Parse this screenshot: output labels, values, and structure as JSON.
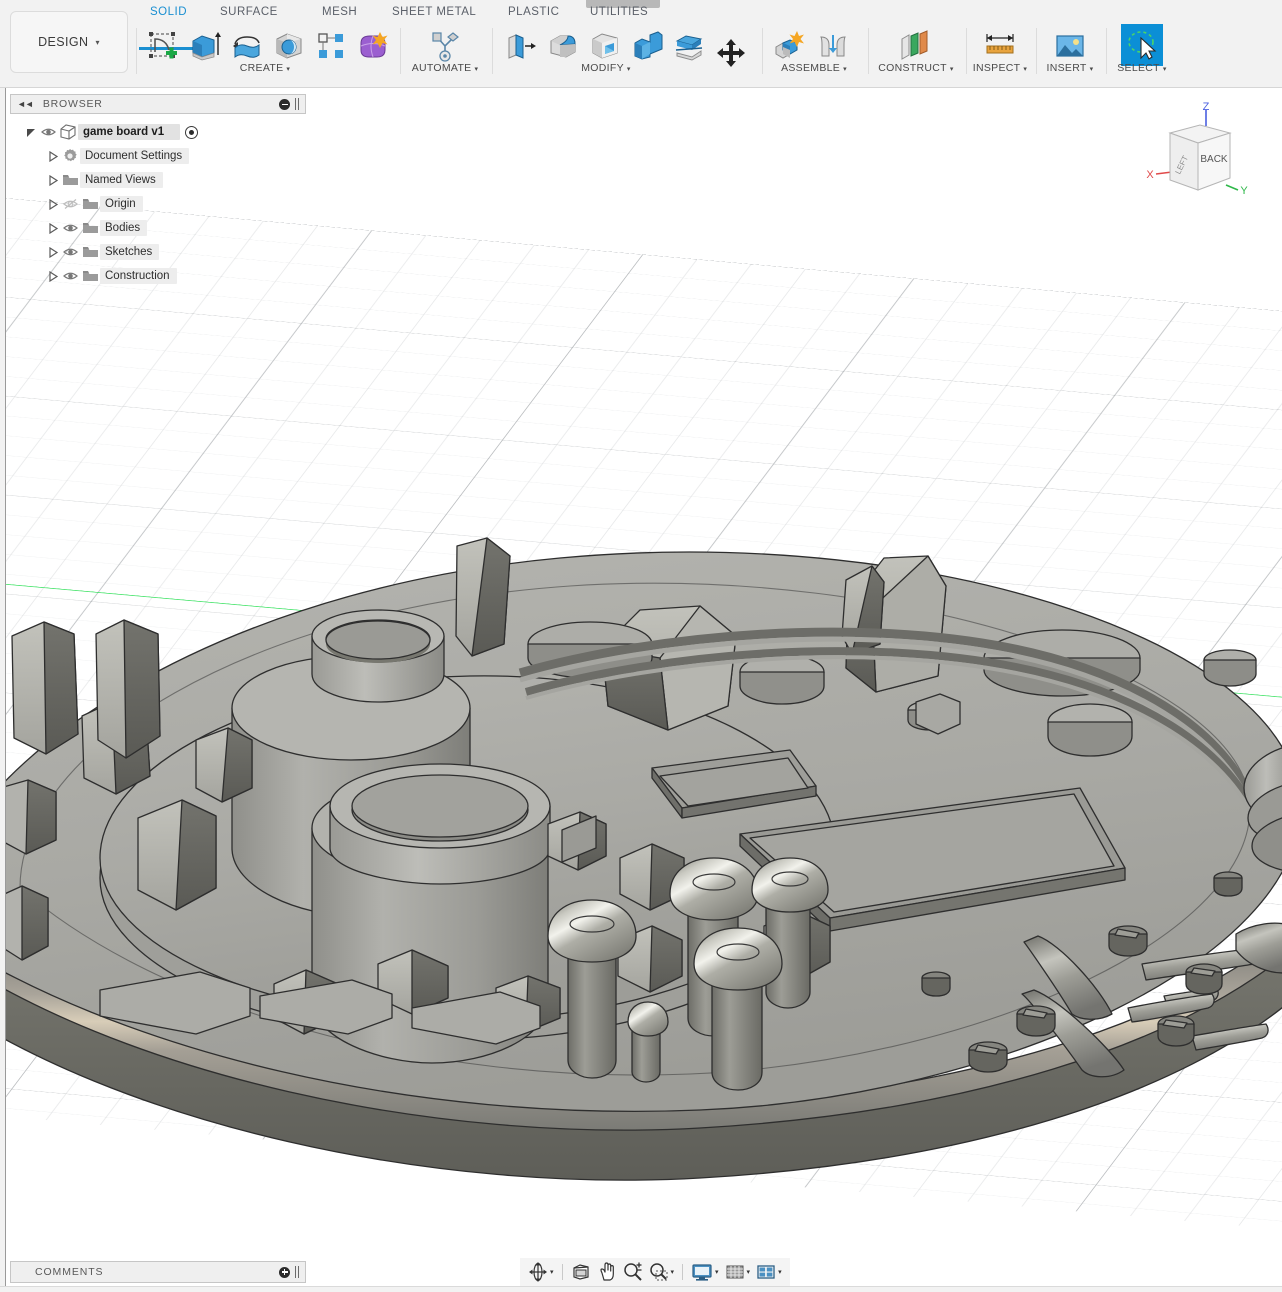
{
  "app": {
    "workspace_button": "DESIGN",
    "caret_glyph": "▾"
  },
  "tabs": [
    {
      "label": "SOLID",
      "active": true
    },
    {
      "label": "SURFACE",
      "active": false
    },
    {
      "label": "MESH",
      "active": false
    },
    {
      "label": "SHEET METAL",
      "active": false
    },
    {
      "label": "PLASTIC",
      "active": false
    },
    {
      "label": "UTILITIES",
      "active": false
    }
  ],
  "toolbar_groups": [
    {
      "label": "CREATE",
      "has_caret": true,
      "icons": [
        "new-sketch-icon",
        "extrude-icon",
        "revolve-icon",
        "sphere-icon",
        "pattern-icon",
        "form-icon"
      ]
    },
    {
      "label": "AUTOMATE",
      "has_caret": true,
      "icons": [
        "automate-icon"
      ]
    },
    {
      "label": "MODIFY",
      "has_caret": true,
      "icons": [
        "press-pull-icon",
        "fillet-icon",
        "shell-icon",
        "combine-icon",
        "offset-face-icon",
        "move-copy-icon"
      ]
    },
    {
      "label": "ASSEMBLE",
      "has_caret": true,
      "icons": [
        "new-component-icon",
        "joint-icon"
      ]
    },
    {
      "label": "CONSTRUCT",
      "has_caret": true,
      "icons": [
        "offset-plane-icon"
      ]
    },
    {
      "label": "INSPECT",
      "has_caret": true,
      "icons": [
        "measure-icon"
      ]
    },
    {
      "label": "INSERT",
      "has_caret": true,
      "icons": [
        "insert-image-icon"
      ]
    },
    {
      "label": "SELECT",
      "has_caret": true,
      "icons": [
        "select-lasso-icon"
      ],
      "selected": true
    }
  ],
  "browser": {
    "title": "BROWSER",
    "collapse_glyph": "◄◄",
    "minus_icon": "circle-minus-icon",
    "grip_icon": "panel-grip-icon",
    "tree": [
      {
        "label": "game board v1",
        "level": 0,
        "is_root": true,
        "expanded": true,
        "icon": "component-cube-icon",
        "eye": "visible",
        "has_radio": true
      },
      {
        "label": "Document Settings",
        "level": 1,
        "icon": "gear-icon",
        "eye": "none",
        "expanded": false
      },
      {
        "label": "Named Views",
        "level": 1,
        "icon": "folder-icon",
        "eye": "none",
        "expanded": false
      },
      {
        "label": "Origin",
        "level": 1,
        "icon": "folder-icon",
        "eye": "hidden",
        "expanded": false
      },
      {
        "label": "Bodies",
        "level": 1,
        "icon": "folder-icon",
        "eye": "visible",
        "expanded": false
      },
      {
        "label": "Sketches",
        "level": 1,
        "icon": "folder-icon",
        "eye": "visible",
        "expanded": false
      },
      {
        "label": "Construction",
        "level": 1,
        "icon": "folder-icon",
        "eye": "visible",
        "expanded": false
      }
    ]
  },
  "viewcube": {
    "front_face_label": "BACK",
    "side_face_label": "LEFT",
    "axis_z_label": "Z",
    "axis_x_label": "X",
    "axis_y_label": "Y",
    "axis_z_color": "#4a5fe0",
    "axis_x_color": "#e04a4a",
    "axis_y_color": "#2fb84a"
  },
  "comments": {
    "title": "COMMENTS",
    "plus_icon": "circle-plus-icon",
    "grip_icon": "panel-grip-icon"
  },
  "navbar": {
    "items": [
      {
        "icon": "orbit-icon",
        "caret": true
      },
      {
        "icon": "look-at-icon",
        "caret": false
      },
      {
        "icon": "pan-icon",
        "caret": false
      },
      {
        "icon": "zoom-icon",
        "caret": false
      },
      {
        "icon": "zoom-window-icon",
        "caret": true
      },
      {
        "icon": "display-settings-icon",
        "caret": true
      },
      {
        "icon": "grid-snaps-icon",
        "caret": true
      },
      {
        "icon": "viewport-layout-icon",
        "caret": true
      }
    ]
  },
  "viewport": {
    "background_color": "#ffffff",
    "grid_major_color": "#787d82",
    "grid_minor_color": "#969ba0",
    "y_axis_color": "#31e05a",
    "x_axis_color": "#eb4646",
    "model_name": "game board v1",
    "model_base_color": "#a8a8a3",
    "model_edge_color": "#2e2e2e",
    "model_shadow_color": "#6e6e6a"
  }
}
